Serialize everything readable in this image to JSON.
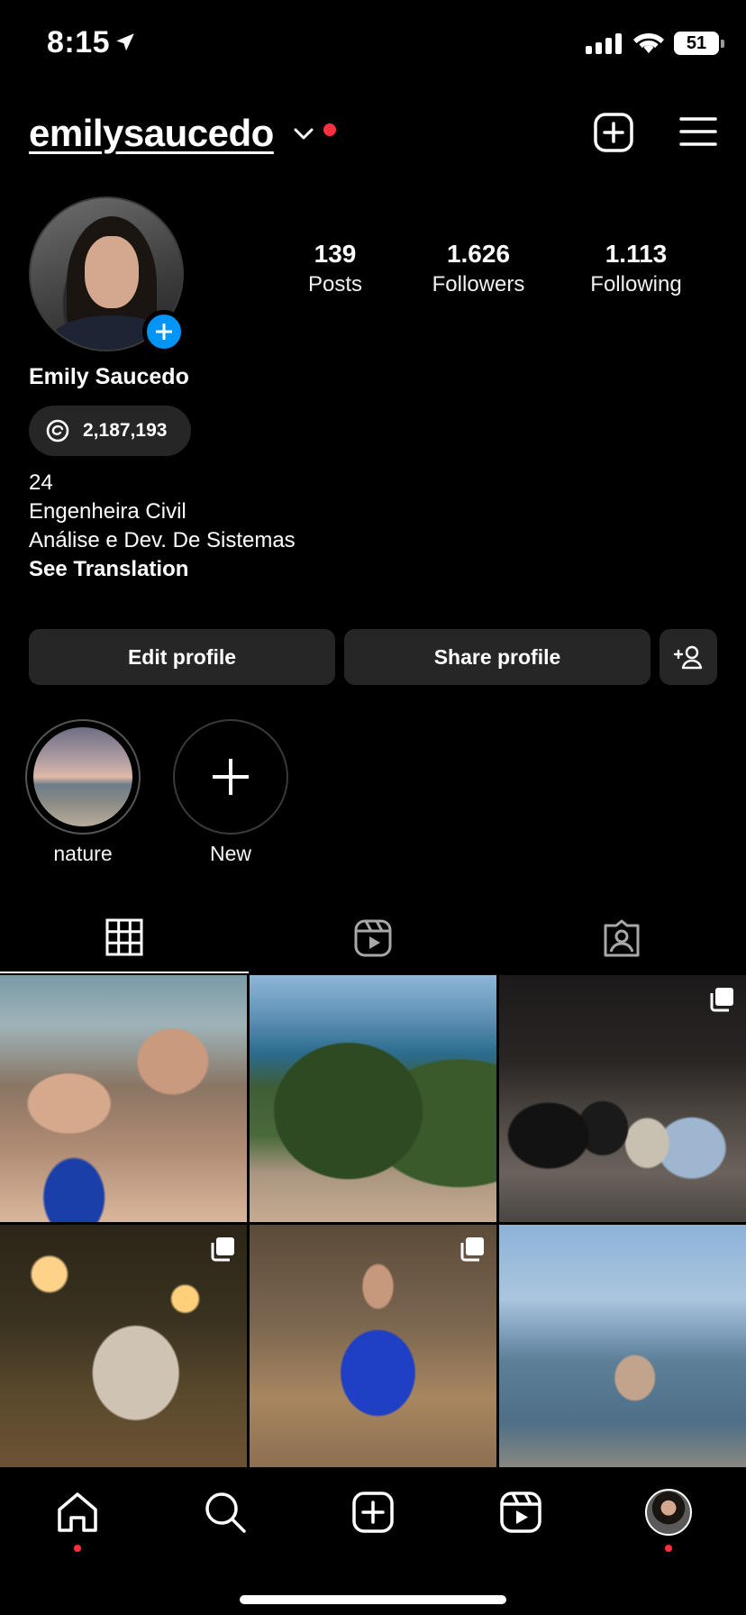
{
  "status_bar": {
    "time": "8:15",
    "battery": "51"
  },
  "header": {
    "username": "emilysaucedo"
  },
  "profile": {
    "stats": [
      {
        "number": "139",
        "label": "Posts"
      },
      {
        "number": "1.626",
        "label": "Followers"
      },
      {
        "number": "1.113",
        "label": "Following"
      }
    ],
    "full_name": "Emily Saucedo",
    "threads_count": "2,187,193",
    "bio": [
      "24",
      "Engenheira Civil",
      "Análise e Dev. De Sistemas"
    ],
    "see_translation": "See Translation"
  },
  "buttons": {
    "edit": "Edit profile",
    "share": "Share profile"
  },
  "highlights": [
    {
      "label": "nature"
    },
    {
      "label": "New"
    }
  ],
  "tabs": [
    "grid-icon",
    "reels-icon",
    "tagged-icon"
  ],
  "grid": {
    "posts": 6,
    "multi_posts": [
      3,
      4,
      5
    ]
  },
  "bottom_nav": [
    "home-icon",
    "search-icon",
    "create-icon",
    "reels-icon",
    "profile-avatar"
  ],
  "colors": {
    "accent": "#0095f6",
    "notification": "#ff3040",
    "button_bg": "#262626"
  }
}
